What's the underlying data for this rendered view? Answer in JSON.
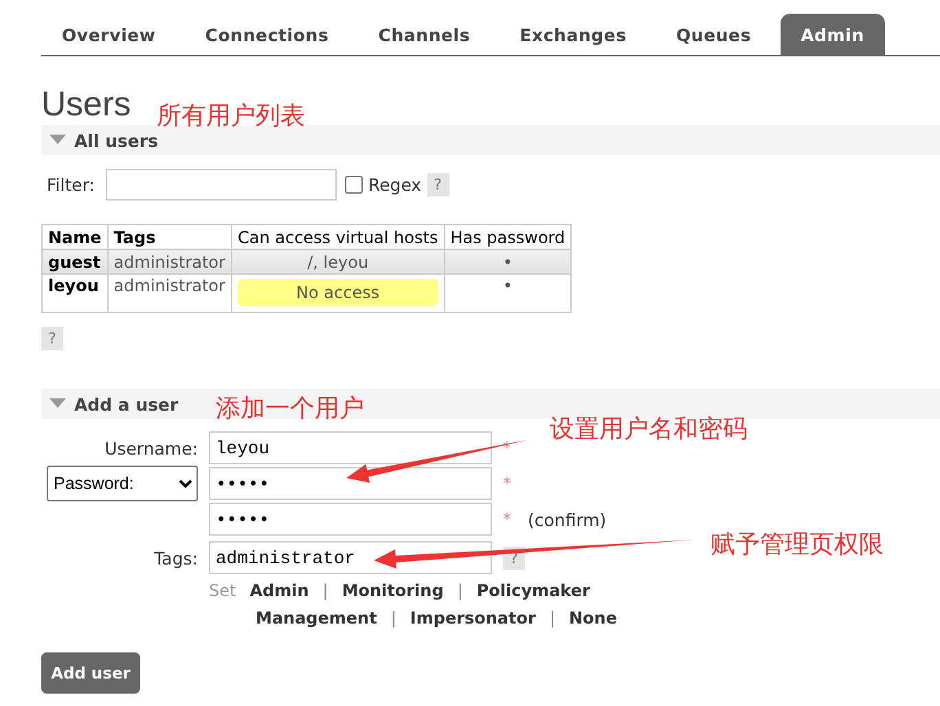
{
  "tabs": [
    {
      "label": "Overview",
      "selected": false
    },
    {
      "label": "Connections",
      "selected": false
    },
    {
      "label": "Channels",
      "selected": false
    },
    {
      "label": "Exchanges",
      "selected": false
    },
    {
      "label": "Queues",
      "selected": false
    },
    {
      "label": "Admin",
      "selected": true
    }
  ],
  "page_title": "Users",
  "all_users": {
    "title": "All users",
    "expanded": true,
    "filter": {
      "label": "Filter:",
      "regex_label": "Regex",
      "regex_checked": false,
      "help": "?"
    },
    "table": {
      "columns": [
        "Name",
        "Tags",
        "Can access virtual hosts",
        "Has password"
      ],
      "rows": [
        {
          "name": "guest",
          "tags": "administrator",
          "vhosts": "/, leyou",
          "warning": false,
          "has_password": "•"
        },
        {
          "name": "leyou",
          "tags": "administrator",
          "vhosts": "No access",
          "warning": true,
          "has_password": "•"
        }
      ]
    },
    "help": "?"
  },
  "add_user": {
    "title": "Add a user",
    "expanded": true,
    "username": {
      "label": "Username:",
      "value": "leyou",
      "marker": "*"
    },
    "password": {
      "mode": "Password:",
      "value": "•••••",
      "marker": "*"
    },
    "confirm": {
      "value": "•••••",
      "marker": "*",
      "note": "(confirm)"
    },
    "tags": {
      "label": "Tags:",
      "value": "administrator",
      "help": "?"
    },
    "set_label": "Set",
    "separator": "|",
    "tag_links": [
      [
        "Admin",
        "Monitoring",
        "Policymaker"
      ],
      [
        "Management",
        "Impersonator",
        "None"
      ]
    ],
    "button": "Add user"
  },
  "annotations": [
    {
      "text": "所有用户列表",
      "arrow": false
    },
    {
      "text": "添加一个用户",
      "arrow": false
    },
    {
      "text": "设置用户名和密码",
      "arrow": true
    },
    {
      "text": "赋予管理页权限",
      "arrow": true
    }
  ]
}
